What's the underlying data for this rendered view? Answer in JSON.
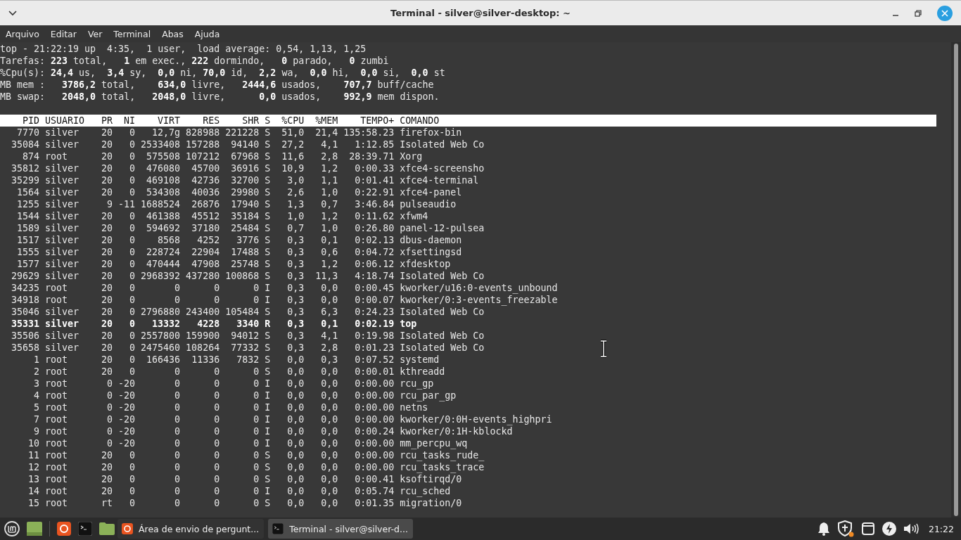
{
  "window": {
    "title": "Terminal - silver@silver-desktop: ~"
  },
  "menu_bar": [
    "Arquivo",
    "Editar",
    "Ver",
    "Terminal",
    "Abas",
    "Ajuda"
  ],
  "terminal": {
    "summary_lines": [
      "top - 21:22:19 up  4:35,  1 user,  load average: 0,54, 1,13, 1,25",
      "Tarefas: **223** total,   **1** em exec., **222** dormindo,   **0** parado,   **0** zumbi",
      "%Cpu(s): **24,4** us,  **3,4** sy,  **0,0** ni, **70,0** id,  **2,2** wa,  **0,0** hi,  **0,0** si,  **0,0** st",
      "MB mem :   **3786,2** total,    **634,0** livre,   **2444,6** usados,    **707,7** buff/cache",
      "MB swap:   **2048,0** total,   **2048,0** livre,      **0,0** usados,    **992,9** mem dispon."
    ],
    "table": {
      "columns": [
        "PID",
        "USUARIO",
        "PR",
        "NI",
        "VIRT",
        "RES",
        "SHR",
        "S",
        "%CPU",
        "%MEM",
        "TEMPO+",
        "COMANDO"
      ],
      "rows": [
        {
          "cells": [
            "7770",
            "silver",
            "20",
            "0",
            "12,7g",
            "828988",
            "221228",
            "S",
            "51,0",
            "21,4",
            "135:58.23",
            "firefox-bin"
          ],
          "highlighted": false
        },
        {
          "cells": [
            "35084",
            "silver",
            "20",
            "0",
            "2533408",
            "157288",
            "94140",
            "S",
            "27,2",
            "4,1",
            "1:12.85",
            "Isolated Web Co"
          ],
          "highlighted": false
        },
        {
          "cells": [
            "874",
            "root",
            "20",
            "0",
            "575508",
            "107212",
            "67968",
            "S",
            "11,6",
            "2,8",
            "28:39.71",
            "Xorg"
          ],
          "highlighted": false
        },
        {
          "cells": [
            "35812",
            "silver",
            "20",
            "0",
            "476080",
            "45700",
            "36916",
            "S",
            "10,9",
            "1,2",
            "0:00.33",
            "xfce4-screensho"
          ],
          "highlighted": false
        },
        {
          "cells": [
            "35299",
            "silver",
            "20",
            "0",
            "469108",
            "42736",
            "32700",
            "S",
            "3,0",
            "1,1",
            "0:01.41",
            "xfce4-terminal"
          ],
          "highlighted": false
        },
        {
          "cells": [
            "1564",
            "silver",
            "20",
            "0",
            "534308",
            "40036",
            "29980",
            "S",
            "2,6",
            "1,0",
            "0:22.91",
            "xfce4-panel"
          ],
          "highlighted": false
        },
        {
          "cells": [
            "1255",
            "silver",
            "9",
            "-11",
            "1688524",
            "26876",
            "17940",
            "S",
            "1,3",
            "0,7",
            "3:46.84",
            "pulseaudio"
          ],
          "highlighted": false
        },
        {
          "cells": [
            "1544",
            "silver",
            "20",
            "0",
            "461388",
            "45512",
            "35184",
            "S",
            "1,0",
            "1,2",
            "0:11.62",
            "xfwm4"
          ],
          "highlighted": false
        },
        {
          "cells": [
            "1589",
            "silver",
            "20",
            "0",
            "594692",
            "37180",
            "25484",
            "S",
            "0,7",
            "1,0",
            "0:26.80",
            "panel-12-pulsea"
          ],
          "highlighted": false
        },
        {
          "cells": [
            "1517",
            "silver",
            "20",
            "0",
            "8568",
            "4252",
            "3776",
            "S",
            "0,3",
            "0,1",
            "0:02.13",
            "dbus-daemon"
          ],
          "highlighted": false
        },
        {
          "cells": [
            "1555",
            "silver",
            "20",
            "0",
            "228724",
            "22904",
            "17488",
            "S",
            "0,3",
            "0,6",
            "0:04.72",
            "xfsettingsd"
          ],
          "highlighted": false
        },
        {
          "cells": [
            "1577",
            "silver",
            "20",
            "0",
            "470444",
            "47908",
            "25748",
            "S",
            "0,3",
            "1,2",
            "0:06.12",
            "xfdesktop"
          ],
          "highlighted": false
        },
        {
          "cells": [
            "29629",
            "silver",
            "20",
            "0",
            "2968392",
            "437280",
            "100868",
            "S",
            "0,3",
            "11,3",
            "4:18.74",
            "Isolated Web Co"
          ],
          "highlighted": false
        },
        {
          "cells": [
            "34235",
            "root",
            "20",
            "0",
            "0",
            "0",
            "0",
            "I",
            "0,3",
            "0,0",
            "0:00.45",
            "kworker/u16:0-events_unbound"
          ],
          "highlighted": false
        },
        {
          "cells": [
            "34918",
            "root",
            "20",
            "0",
            "0",
            "0",
            "0",
            "I",
            "0,3",
            "0,0",
            "0:00.07",
            "kworker/0:3-events_freezable"
          ],
          "highlighted": false
        },
        {
          "cells": [
            "35046",
            "silver",
            "20",
            "0",
            "2796880",
            "243400",
            "105484",
            "S",
            "0,3",
            "6,3",
            "0:24.23",
            "Isolated Web Co"
          ],
          "highlighted": false
        },
        {
          "cells": [
            "35331",
            "silver",
            "20",
            "0",
            "13332",
            "4228",
            "3340",
            "R",
            "0,3",
            "0,1",
            "0:02.19",
            "top"
          ],
          "highlighted": true
        },
        {
          "cells": [
            "35506",
            "silver",
            "20",
            "0",
            "2557800",
            "159900",
            "94012",
            "S",
            "0,3",
            "4,1",
            "0:19.98",
            "Isolated Web Co"
          ],
          "highlighted": false
        },
        {
          "cells": [
            "35658",
            "silver",
            "20",
            "0",
            "2475460",
            "108264",
            "77332",
            "S",
            "0,3",
            "2,8",
            "0:01.23",
            "Isolated Web Co"
          ],
          "highlighted": false
        },
        {
          "cells": [
            "1",
            "root",
            "20",
            "0",
            "166436",
            "11336",
            "7832",
            "S",
            "0,0",
            "0,3",
            "0:07.52",
            "systemd"
          ],
          "highlighted": false
        },
        {
          "cells": [
            "2",
            "root",
            "20",
            "0",
            "0",
            "0",
            "0",
            "S",
            "0,0",
            "0,0",
            "0:00.01",
            "kthreadd"
          ],
          "highlighted": false
        },
        {
          "cells": [
            "3",
            "root",
            "0",
            "-20",
            "0",
            "0",
            "0",
            "I",
            "0,0",
            "0,0",
            "0:00.00",
            "rcu_gp"
          ],
          "highlighted": false
        },
        {
          "cells": [
            "4",
            "root",
            "0",
            "-20",
            "0",
            "0",
            "0",
            "I",
            "0,0",
            "0,0",
            "0:00.00",
            "rcu_par_gp"
          ],
          "highlighted": false
        },
        {
          "cells": [
            "5",
            "root",
            "0",
            "-20",
            "0",
            "0",
            "0",
            "I",
            "0,0",
            "0,0",
            "0:00.00",
            "netns"
          ],
          "highlighted": false
        },
        {
          "cells": [
            "7",
            "root",
            "0",
            "-20",
            "0",
            "0",
            "0",
            "I",
            "0,0",
            "0,0",
            "0:00.00",
            "kworker/0:0H-events_highpri"
          ],
          "highlighted": false
        },
        {
          "cells": [
            "9",
            "root",
            "0",
            "-20",
            "0",
            "0",
            "0",
            "I",
            "0,0",
            "0,0",
            "0:00.24",
            "kworker/0:1H-kblockd"
          ],
          "highlighted": false
        },
        {
          "cells": [
            "10",
            "root",
            "0",
            "-20",
            "0",
            "0",
            "0",
            "I",
            "0,0",
            "0,0",
            "0:00.00",
            "mm_percpu_wq"
          ],
          "highlighted": false
        },
        {
          "cells": [
            "11",
            "root",
            "20",
            "0",
            "0",
            "0",
            "0",
            "S",
            "0,0",
            "0,0",
            "0:00.00",
            "rcu_tasks_rude_"
          ],
          "highlighted": false
        },
        {
          "cells": [
            "12",
            "root",
            "20",
            "0",
            "0",
            "0",
            "0",
            "S",
            "0,0",
            "0,0",
            "0:00.00",
            "rcu_tasks_trace"
          ],
          "highlighted": false
        },
        {
          "cells": [
            "13",
            "root",
            "20",
            "0",
            "0",
            "0",
            "0",
            "S",
            "0,0",
            "0,0",
            "0:00.41",
            "ksoftirqd/0"
          ],
          "highlighted": false
        },
        {
          "cells": [
            "14",
            "root",
            "20",
            "0",
            "0",
            "0",
            "0",
            "I",
            "0,0",
            "0,0",
            "0:05.74",
            "rcu_sched"
          ],
          "highlighted": false
        },
        {
          "cells": [
            "15",
            "root",
            "rt",
            "0",
            "0",
            "0",
            "0",
            "S",
            "0,0",
            "0,0",
            "0:01.35",
            "migration/0"
          ],
          "highlighted": false
        }
      ]
    }
  },
  "taskbar": {
    "windows": [
      {
        "label": "Área de envio de pergunt...",
        "kind": "browser",
        "selected": false
      },
      {
        "label": "Terminal - silver@silver-d...",
        "kind": "terminal",
        "selected": true
      }
    ],
    "clock": "21:22"
  }
}
